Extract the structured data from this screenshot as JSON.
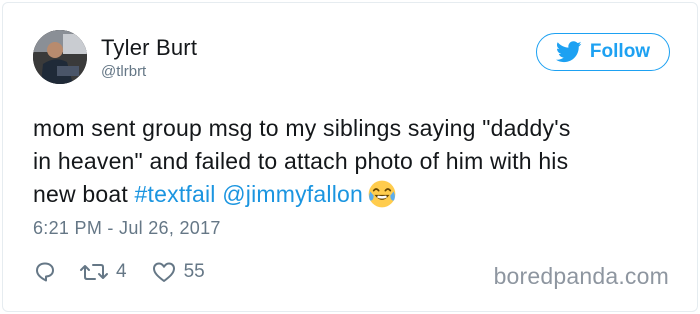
{
  "user": {
    "name": "Tyler Burt",
    "handle": "@tlrbrt"
  },
  "follow_button": {
    "label": "Follow",
    "icon": "twitter-bird-icon"
  },
  "tweet": {
    "line1": "mom sent group msg to my siblings saying \"daddy's",
    "line2": "in heaven\" and failed to attach photo of him with his",
    "line3_text": "new boat ",
    "hashtag": "#textfail",
    "mention": "@jimmyfallon",
    "emoji": "face-with-tears-of-joy",
    "timestamp": "6:21 PM - Jul 26, 2017"
  },
  "actions": {
    "reply_icon": "reply-icon",
    "retweet_icon": "retweet-icon",
    "retweet_count": "4",
    "like_icon": "heart-icon",
    "like_count": "55"
  },
  "watermark": "boredpanda.com",
  "colors": {
    "accent": "#1da1f2",
    "link": "#1b95e0",
    "secondary_text": "#657786",
    "primary_text": "#14171a"
  }
}
